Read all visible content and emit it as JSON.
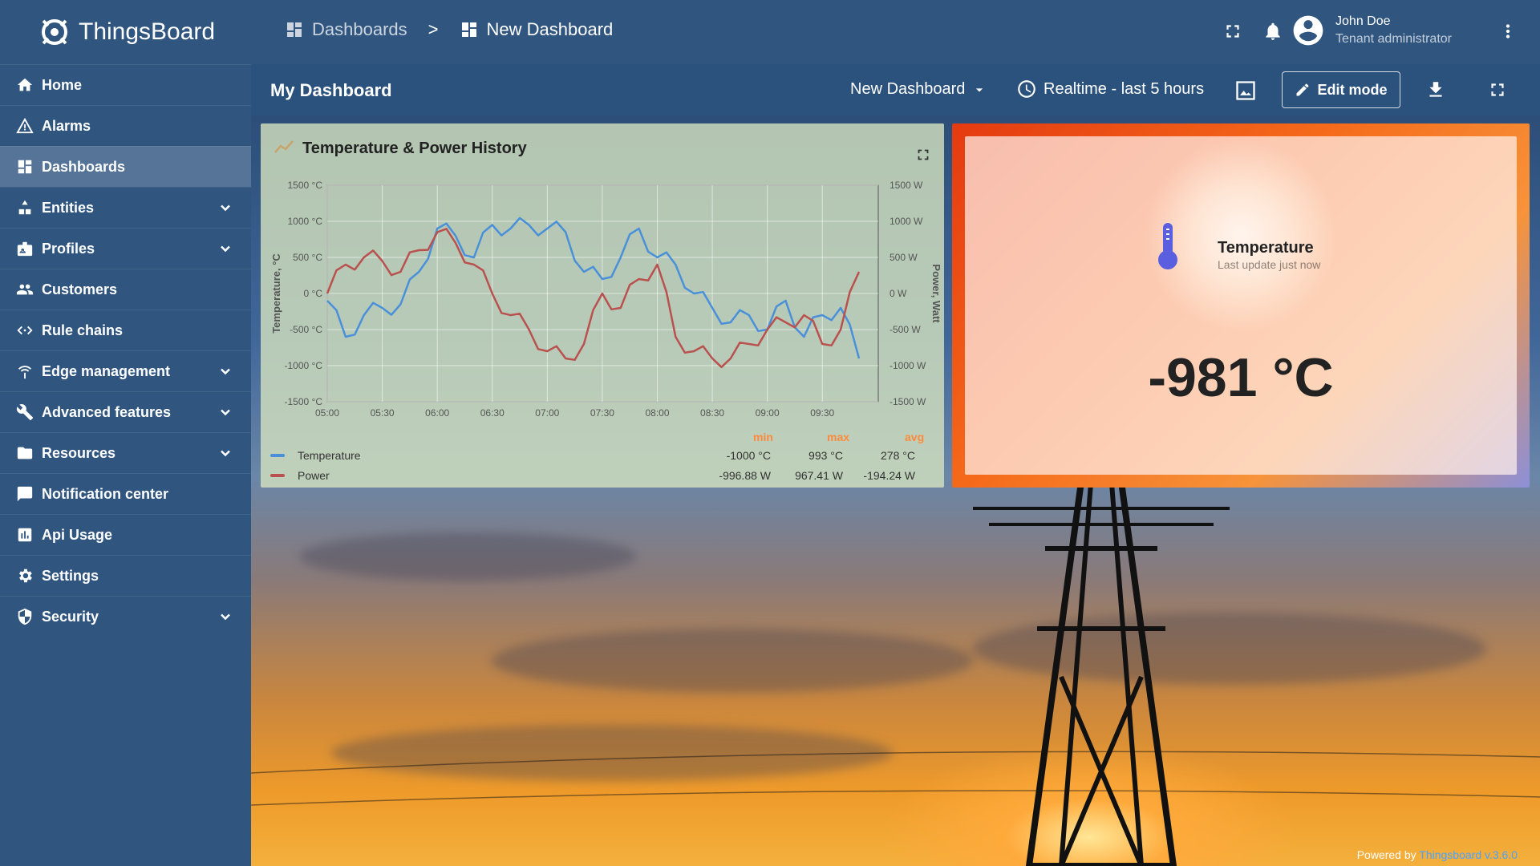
{
  "app": {
    "name": "ThingsBoard"
  },
  "sidebar": {
    "items": [
      {
        "label": "Home",
        "icon": "home-icon"
      },
      {
        "label": "Alarms",
        "icon": "alarm-icon"
      },
      {
        "label": "Dashboards",
        "icon": "dashboard-icon",
        "active": true
      },
      {
        "label": "Entities",
        "icon": "entities-icon",
        "expandable": true
      },
      {
        "label": "Profiles",
        "icon": "profiles-icon",
        "expandable": true
      },
      {
        "label": "Customers",
        "icon": "customers-icon"
      },
      {
        "label": "Rule chains",
        "icon": "rule-chains-icon"
      },
      {
        "label": "Edge management",
        "icon": "edge-icon",
        "expandable": true
      },
      {
        "label": "Advanced features",
        "icon": "tools-icon",
        "expandable": true
      },
      {
        "label": "Resources",
        "icon": "folder-icon",
        "expandable": true
      },
      {
        "label": "Notification center",
        "icon": "notification-icon"
      },
      {
        "label": "Api Usage",
        "icon": "api-usage-icon"
      },
      {
        "label": "Settings",
        "icon": "gear-icon"
      },
      {
        "label": "Security",
        "icon": "shield-icon",
        "expandable": true
      }
    ]
  },
  "header": {
    "breadcrumb": [
      {
        "label": "Dashboards"
      },
      {
        "label": "New Dashboard"
      }
    ],
    "breadcrumb_sep": ">",
    "user": {
      "name": "John Doe",
      "role": "Tenant administrator"
    }
  },
  "toolbar": {
    "dashboard_title": "My Dashboard",
    "dashboard_select": "New Dashboard",
    "timewindow": "Realtime - last 5 hours",
    "edit_label": "Edit mode"
  },
  "chart_widget": {
    "title": "Temperature & Power History",
    "legend_headers": {
      "min": "min",
      "max": "max",
      "avg": "avg"
    },
    "legend": [
      {
        "name": "Temperature",
        "min": "-1000 °C",
        "max": "993 °C",
        "avg": "278 °C",
        "color": "#4a90d9"
      },
      {
        "name": "Power",
        "min": "-996.88 W",
        "max": "967.41 W",
        "avg": "-194.24 W",
        "color": "#b9514e"
      }
    ]
  },
  "chart_data": {
    "type": "line",
    "title": "Temperature & Power History",
    "xlabel": "",
    "ylabel": "Temperature, °C",
    "ylabel_right": "Power, Watt",
    "x": [
      "05:00",
      "05:10",
      "05:20",
      "05:30",
      "05:40",
      "05:50",
      "06:00",
      "06:10",
      "06:20",
      "06:30",
      "06:40",
      "06:50",
      "07:00",
      "07:10",
      "07:20",
      "07:30",
      "07:40",
      "07:50",
      "08:00",
      "08:10",
      "08:20",
      "08:30",
      "08:40",
      "08:50",
      "09:00",
      "09:10",
      "09:20",
      "09:30",
      "09:40",
      "09:50"
    ],
    "x_tick_labels": [
      "05:00",
      "05:30",
      "06:00",
      "06:30",
      "07:00",
      "07:30",
      "08:00",
      "08:30",
      "09:00",
      "09:30"
    ],
    "y_tick_labels_left": [
      "1500 °C",
      "1000 °C",
      "500 °C",
      "0 °C",
      "-500 °C",
      "-1000 °C",
      "-1500 °C"
    ],
    "y_tick_labels_right": [
      "1500 W",
      "1000 W",
      "500 W",
      "0 W",
      "-500 W",
      "-1000 W",
      "-1500 W"
    ],
    "ylim": [
      -1500,
      1500
    ],
    "grid": true,
    "series": [
      {
        "name": "Temperature",
        "values": [
          -100,
          -600,
          -300,
          -200,
          -150,
          300,
          900,
          800,
          500,
          950,
          900,
          950,
          900,
          850,
          300,
          200,
          500,
          900,
          500,
          400,
          0,
          -200,
          -400,
          -300,
          -500,
          -100,
          -600,
          -300,
          -200,
          -900
        ]
      },
      {
        "name": "Power",
        "values": [
          0,
          400,
          500,
          450,
          300,
          600,
          850,
          700,
          400,
          0,
          -300,
          -500,
          -800,
          -900,
          -700,
          0,
          -200,
          200,
          400,
          -600,
          -800,
          -900,
          -900,
          -700,
          -500,
          -400,
          -300,
          -700,
          -500,
          300
        ]
      }
    ]
  },
  "temp_widget": {
    "label": "Temperature",
    "sub": "Last update just now",
    "value": "-981 °C"
  },
  "footer": {
    "powered": "Powered by",
    "link": "Thingsboard v.3.6.0"
  }
}
